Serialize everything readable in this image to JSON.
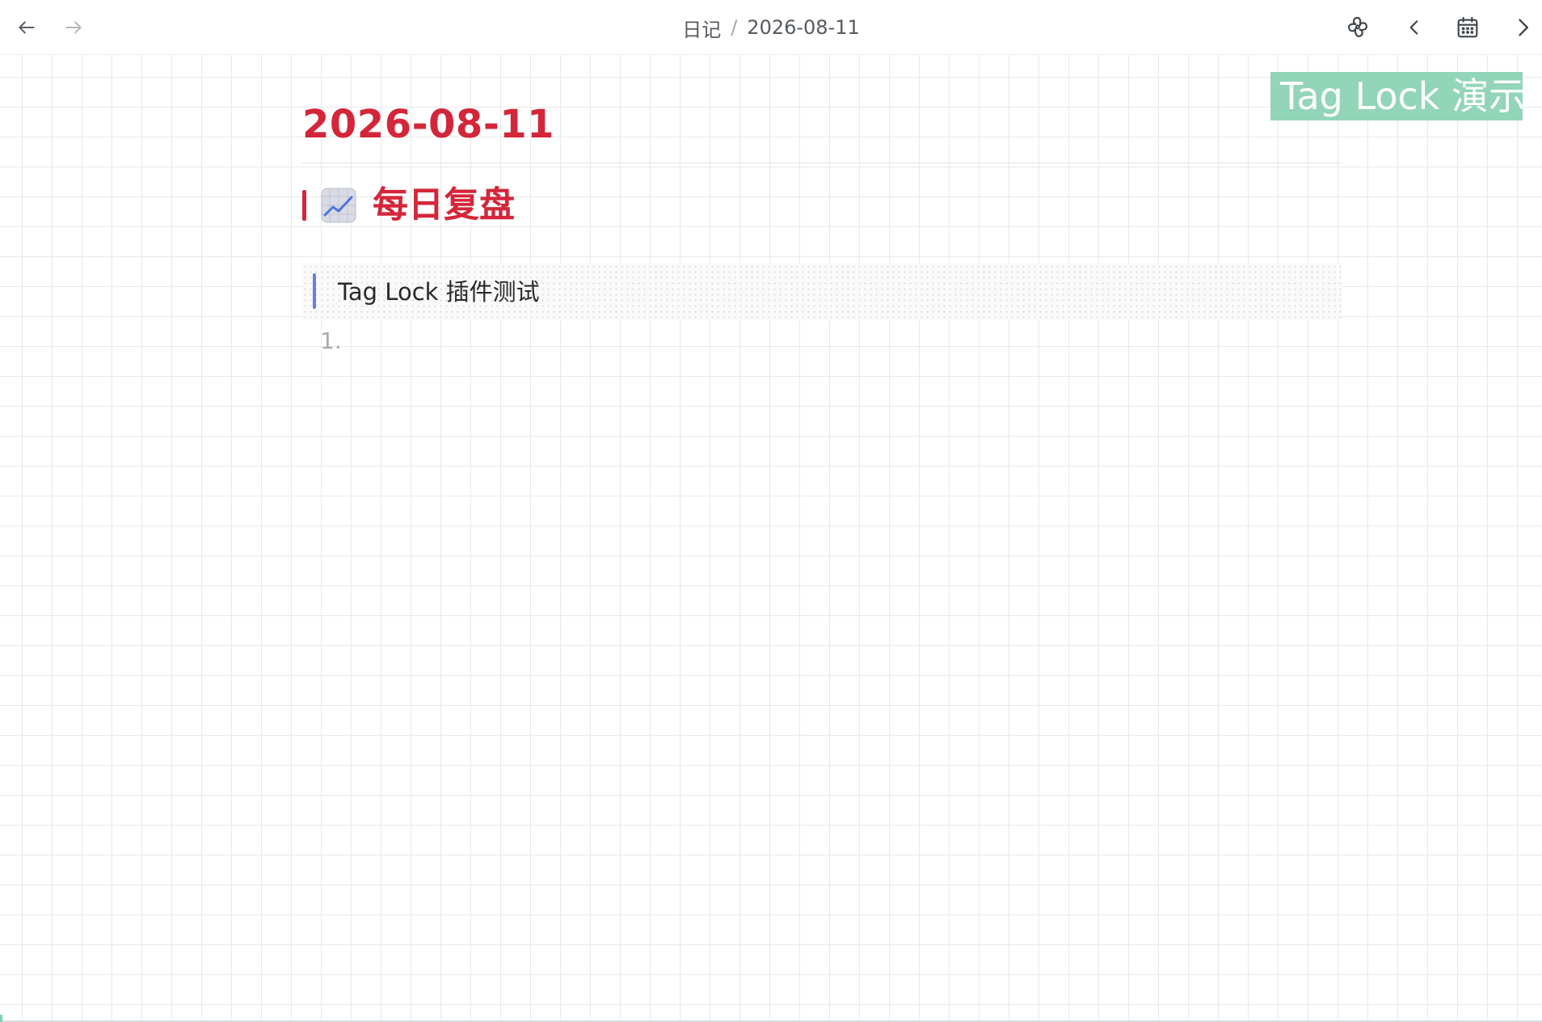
{
  "breadcrumb": {
    "parent": "日记",
    "separator": "/",
    "current": "2026-08-11"
  },
  "toolbar": {
    "back_icon": "arrow-left-icon",
    "forward_icon": "arrow-right-icon",
    "sync_icon": "sync-icon",
    "prev_icon": "chevron-left-icon",
    "calendar_icon": "calendar-icon",
    "next_icon": "chevron-right-icon"
  },
  "document": {
    "title": "2026-08-11",
    "heading": {
      "emoji_icon": "chart-increasing-icon",
      "text": "每日复盘"
    },
    "quote": "Tag Lock 插件测试",
    "list_marker": "1."
  },
  "tag_badge": "Tag Lock 演示",
  "colors": {
    "accent_red": "#d4263a",
    "quote_bar": "#6b7fd7",
    "tag_badge_bg": "#92d5b9",
    "grid_line": "#e9e9e9"
  }
}
